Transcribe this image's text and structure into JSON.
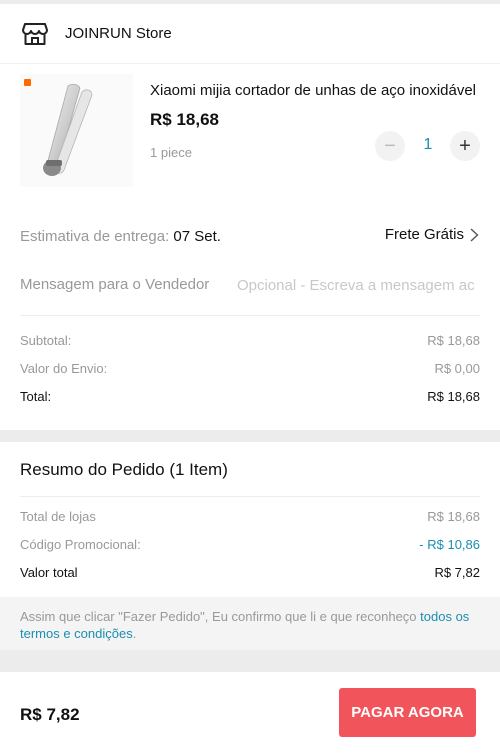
{
  "store": {
    "name": "JOINRUN Store",
    "icon": "store-icon"
  },
  "product": {
    "title": "Xiaomi mijia cortador de unhas de aço inoxidável",
    "price": "R$ 18,68",
    "variant": "1 piece",
    "quantity": "1",
    "image_icon": "nail-clipper-image",
    "minus_label": "−",
    "plus_label": "+"
  },
  "delivery": {
    "label": "Estimativa de entrega:",
    "date": "07 Set.",
    "shipping": "Frete Grátis"
  },
  "message": {
    "label": "Mensagem para o Vendedor",
    "placeholder": "Opcional - Escreva a mensagem ac"
  },
  "store_summary": {
    "subtotal_label": "Subtotal:",
    "subtotal_value": "R$ 18,68",
    "shipping_label": "Valor do Envio:",
    "shipping_value": "R$ 0,00",
    "total_label": "Total:",
    "total_value": "R$ 18,68"
  },
  "order_summary": {
    "title": "Resumo do Pedido (1 Item)",
    "stores_total_label": "Total de lojas",
    "stores_total_value": "R$ 18,68",
    "promo_label": "Código Promocional:",
    "promo_value": "- R$ 10,86",
    "grand_total_label": "Valor total",
    "grand_total_value": "R$ 7,82"
  },
  "terms": {
    "text": "Assim que clicar \"Fazer Pedido\", Eu confirmo que li e que reconheço ",
    "link": "todos os termos e condições",
    "end": "."
  },
  "footer": {
    "total": "R$ 7,82",
    "pay_button": "PAGAR AGORA"
  },
  "colors": {
    "accent": "#1a8fb0",
    "pay_button": "#f2545b",
    "brand_badge": "#ff6900"
  }
}
